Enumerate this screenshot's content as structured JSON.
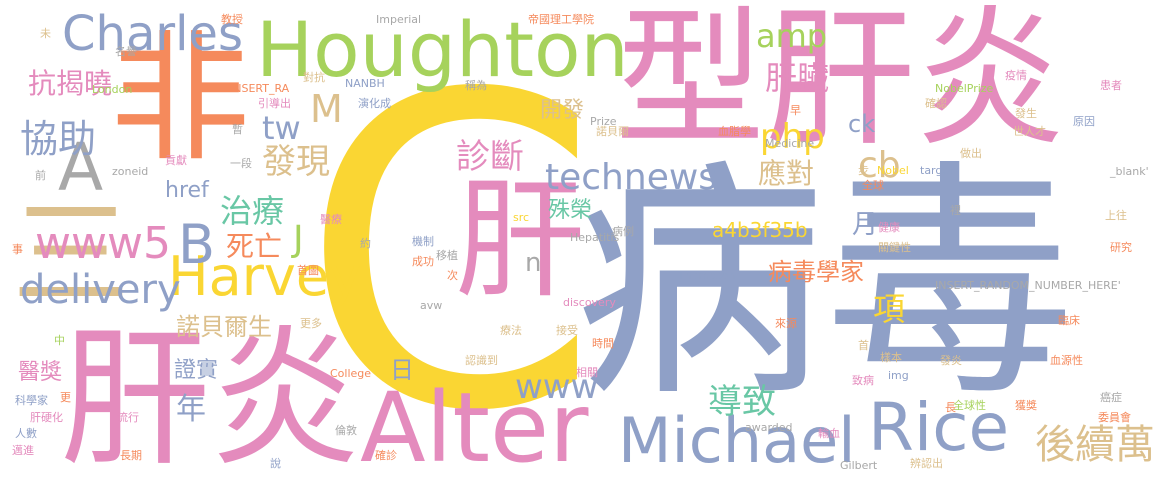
{
  "words": {
    "c": "C",
    "bing_du": "病毒",
    "xing_gan_yan": "型肝炎",
    "gan_yan": "肝炎",
    "fei": "非",
    "gan": "肝",
    "alter": "Alter",
    "houghton": "Houghton",
    "michael": "Michael",
    "rice": "Rice",
    "harvey": "Harvey",
    "charles": "Charles",
    "a_letter": "A",
    "b_letter": "B",
    "san": "三",
    "www5": "www5",
    "delivery": "delivery",
    "technews": "technews",
    "www": "www",
    "hou_xu_wan": "後續萬",
    "php": "php",
    "amp": "amp",
    "m_letter": "M",
    "tw": "tw",
    "xie_zhu": "協助",
    "kang_jie_xiao": "抗揭曉",
    "fa_xian": "發現",
    "zhen_duan": "診斷",
    "zhi_liao": "治療",
    "si_wang": "死亡",
    "j_letter": "J",
    "href": "href",
    "gan_zang": "肝臟",
    "kai_fa": "開發",
    "ying_dui": "應對",
    "cb": "cb",
    "ck": "ck",
    "dao_zhi": "導致",
    "bing_du_xue_jia": "病毒學家",
    "xiang": "項",
    "a4b3f35b": "a4b3f35b",
    "shu_rong": "殊榮",
    "yue": "月",
    "nuo_bei_er_sheng": "諾貝爾生",
    "zheng_shi": "證實",
    "nian": "年",
    "ri": "日",
    "yi_jiang": "醫獎",
    "n_letter": "n",
    "imperial": "Imperial",
    "di_guo_li_gong": "帝國理工學院",
    "insert_ra": "INSERT_RA",
    "nanbh": "NANBH",
    "nobelprize": "NobelPrize",
    "london": "London",
    "prize": "Prize",
    "nuo_bei_guan": "諾貝爾",
    "xue_zhi_xue": "血脂學",
    "medicine": "Medicine",
    "nobel": "Nobel",
    "target": "target",
    "blank": "_blank'",
    "zoneid": "zoneid",
    "src": "src",
    "hepatitis": "Hepatitis",
    "thompson": "Thompson",
    "insert_random": "INSERT_RANDOM_NUMBER_HERE'",
    "discovery": "discovery",
    "avw": "avw",
    "college": "College",
    "awarded": "awarded",
    "gilbert": "Gilbert",
    "img": "img",
    "jiao_shou": "教授",
    "wei": "未",
    "ming_yu": "名譽",
    "feng_kang": "對抗",
    "yin_dao_chu": "引導出",
    "yan_hua_cheng": "演化成",
    "cheng_wei": "稱為",
    "yi_qing": "疫情",
    "huan_zhe": "患者",
    "que_ren": "確認",
    "fa_sheng": "發生",
    "yuan_yin": "原因",
    "shi_jie_ren_cai": "世人才",
    "zuo_chu": "做出",
    "zao": "早",
    "zan": "暫",
    "yi_duan": "一段",
    "gong_xian": "貢獻",
    "qian": "前",
    "bu": "步",
    "quan_qiu": "全球",
    "li": "裡",
    "shang_wang": "上往",
    "jian_kang": "健康",
    "guan_jian_xing": "關鍵性",
    "yan_jiu": "研究",
    "yi_liao": "醫療",
    "yue2": "約",
    "shi": "事",
    "ji_zhi": "機制",
    "yi_zhi": "移植",
    "cheng_gong": "成功",
    "bing_li": "病例",
    "shou_tu": "首圖",
    "ci": "次",
    "jie_shou": "接受",
    "geng_duo": "更多",
    "liao_fa": "療法",
    "zhong": "中",
    "lai_yuan": "來源",
    "lin_chuang": "臨床",
    "shou": "首",
    "yang_ben": "樣本",
    "fa_yan": "發炎",
    "xue_yuan_xing": "血源性",
    "shi_jian": "時間",
    "xiang_guan": "相關",
    "ren_shi_dao": "認識到",
    "zhi_bing": "致病",
    "ai_zheng": "癌症",
    "ke_xue_jia": "科學家",
    "geng": "更",
    "gan_ying_hua": "肝硬化",
    "liu_xing": "流行",
    "ren_shu": "人數",
    "lun_dun": "倫敦",
    "quan_qiu_xing": "全球性",
    "huo_jiang": "獲獎",
    "chang": "長",
    "wei_yuan_hui": "委員會",
    "shu_xue": "輸血",
    "shuo": "說",
    "que_zhen": "確診",
    "chang_qi": "長期",
    "bian_ren_chu": "辨認出",
    "zhao_jin": "邁進"
  }
}
